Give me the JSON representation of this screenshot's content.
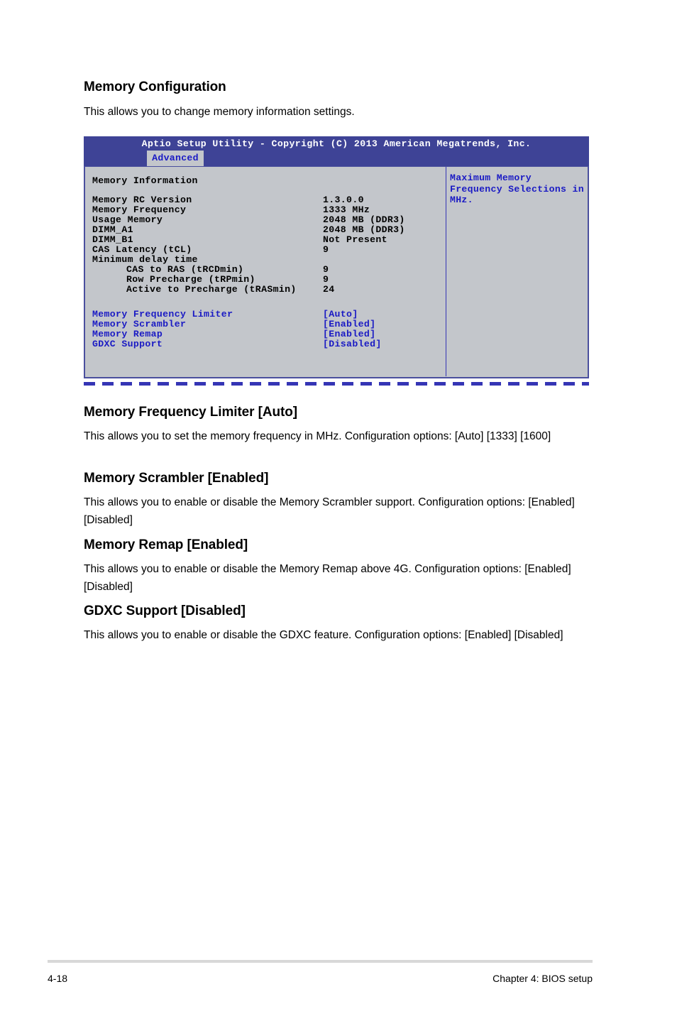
{
  "section": {
    "heading": "Memory Configuration",
    "intro": "This allows you to change memory information settings."
  },
  "bios": {
    "title": "Aptio Setup Utility - Copyright (C) 2013 American Megatrends, Inc.",
    "active_tab": "Advanced",
    "group_heading": "Memory Information",
    "info_rows": [
      {
        "label": "Memory RC Version",
        "value": "1.3.0.0"
      },
      {
        "label": "Memory Frequency",
        "value": "1333 MHz"
      },
      {
        "label": "Usage Memory",
        "value": "2048 MB (DDR3)"
      },
      {
        "label": "DIMM_A1",
        "value": "2048 MB (DDR3)"
      },
      {
        "label": "DIMM_B1",
        "value": "Not Present"
      },
      {
        "label": "CAS Latency (tCL)",
        "value": "9"
      }
    ],
    "delay_heading": "Minimum delay time",
    "delay_rows": [
      {
        "label": "CAS to RAS (tRCDmin)",
        "value": "9"
      },
      {
        "label": "Row Precharge (tRPmin)",
        "value": "9"
      },
      {
        "label": "Active to Precharge (tRASmin)",
        "value": "24"
      }
    ],
    "option_rows": [
      {
        "label": "Memory Frequency Limiter",
        "value": "[Auto]"
      },
      {
        "label": "Memory Scrambler",
        "value": "[Enabled]"
      },
      {
        "label": "Memory Remap",
        "value": "[Enabled]"
      },
      {
        "label": "GDXC Support",
        "value": "[Disabled]"
      }
    ],
    "help_text": "Maximum Memory Frequency Selections in MHz.",
    "colors": {
      "header_bg": "#3e4396",
      "body_bg": "#c3c6cb",
      "accent_blue": "#1a1ac4",
      "border_blue": "#4a4f9e"
    }
  },
  "descriptions": [
    {
      "heading": "Memory Frequency Limiter [Auto]",
      "body": "This allows you to set the memory frequency in MHz. Configuration options: [Auto] [1333] [1600]"
    },
    {
      "heading": "Memory Scrambler [Enabled]",
      "body": "This allows you to enable or disable the Memory Scrambler support. Configuration options: [Enabled] [Disabled]"
    },
    {
      "heading": "Memory Remap [Enabled]",
      "body": "This allows you to enable or disable the Memory Remap above 4G. Configuration options: [Enabled] [Disabled]"
    },
    {
      "heading": "GDXC Support [Disabled]",
      "body": "This allows you to enable or disable the GDXC feature. Configuration options: [Enabled] [Disabled]"
    }
  ],
  "footer": {
    "page_number": "4-18",
    "chapter": "Chapter 4: BIOS setup"
  }
}
